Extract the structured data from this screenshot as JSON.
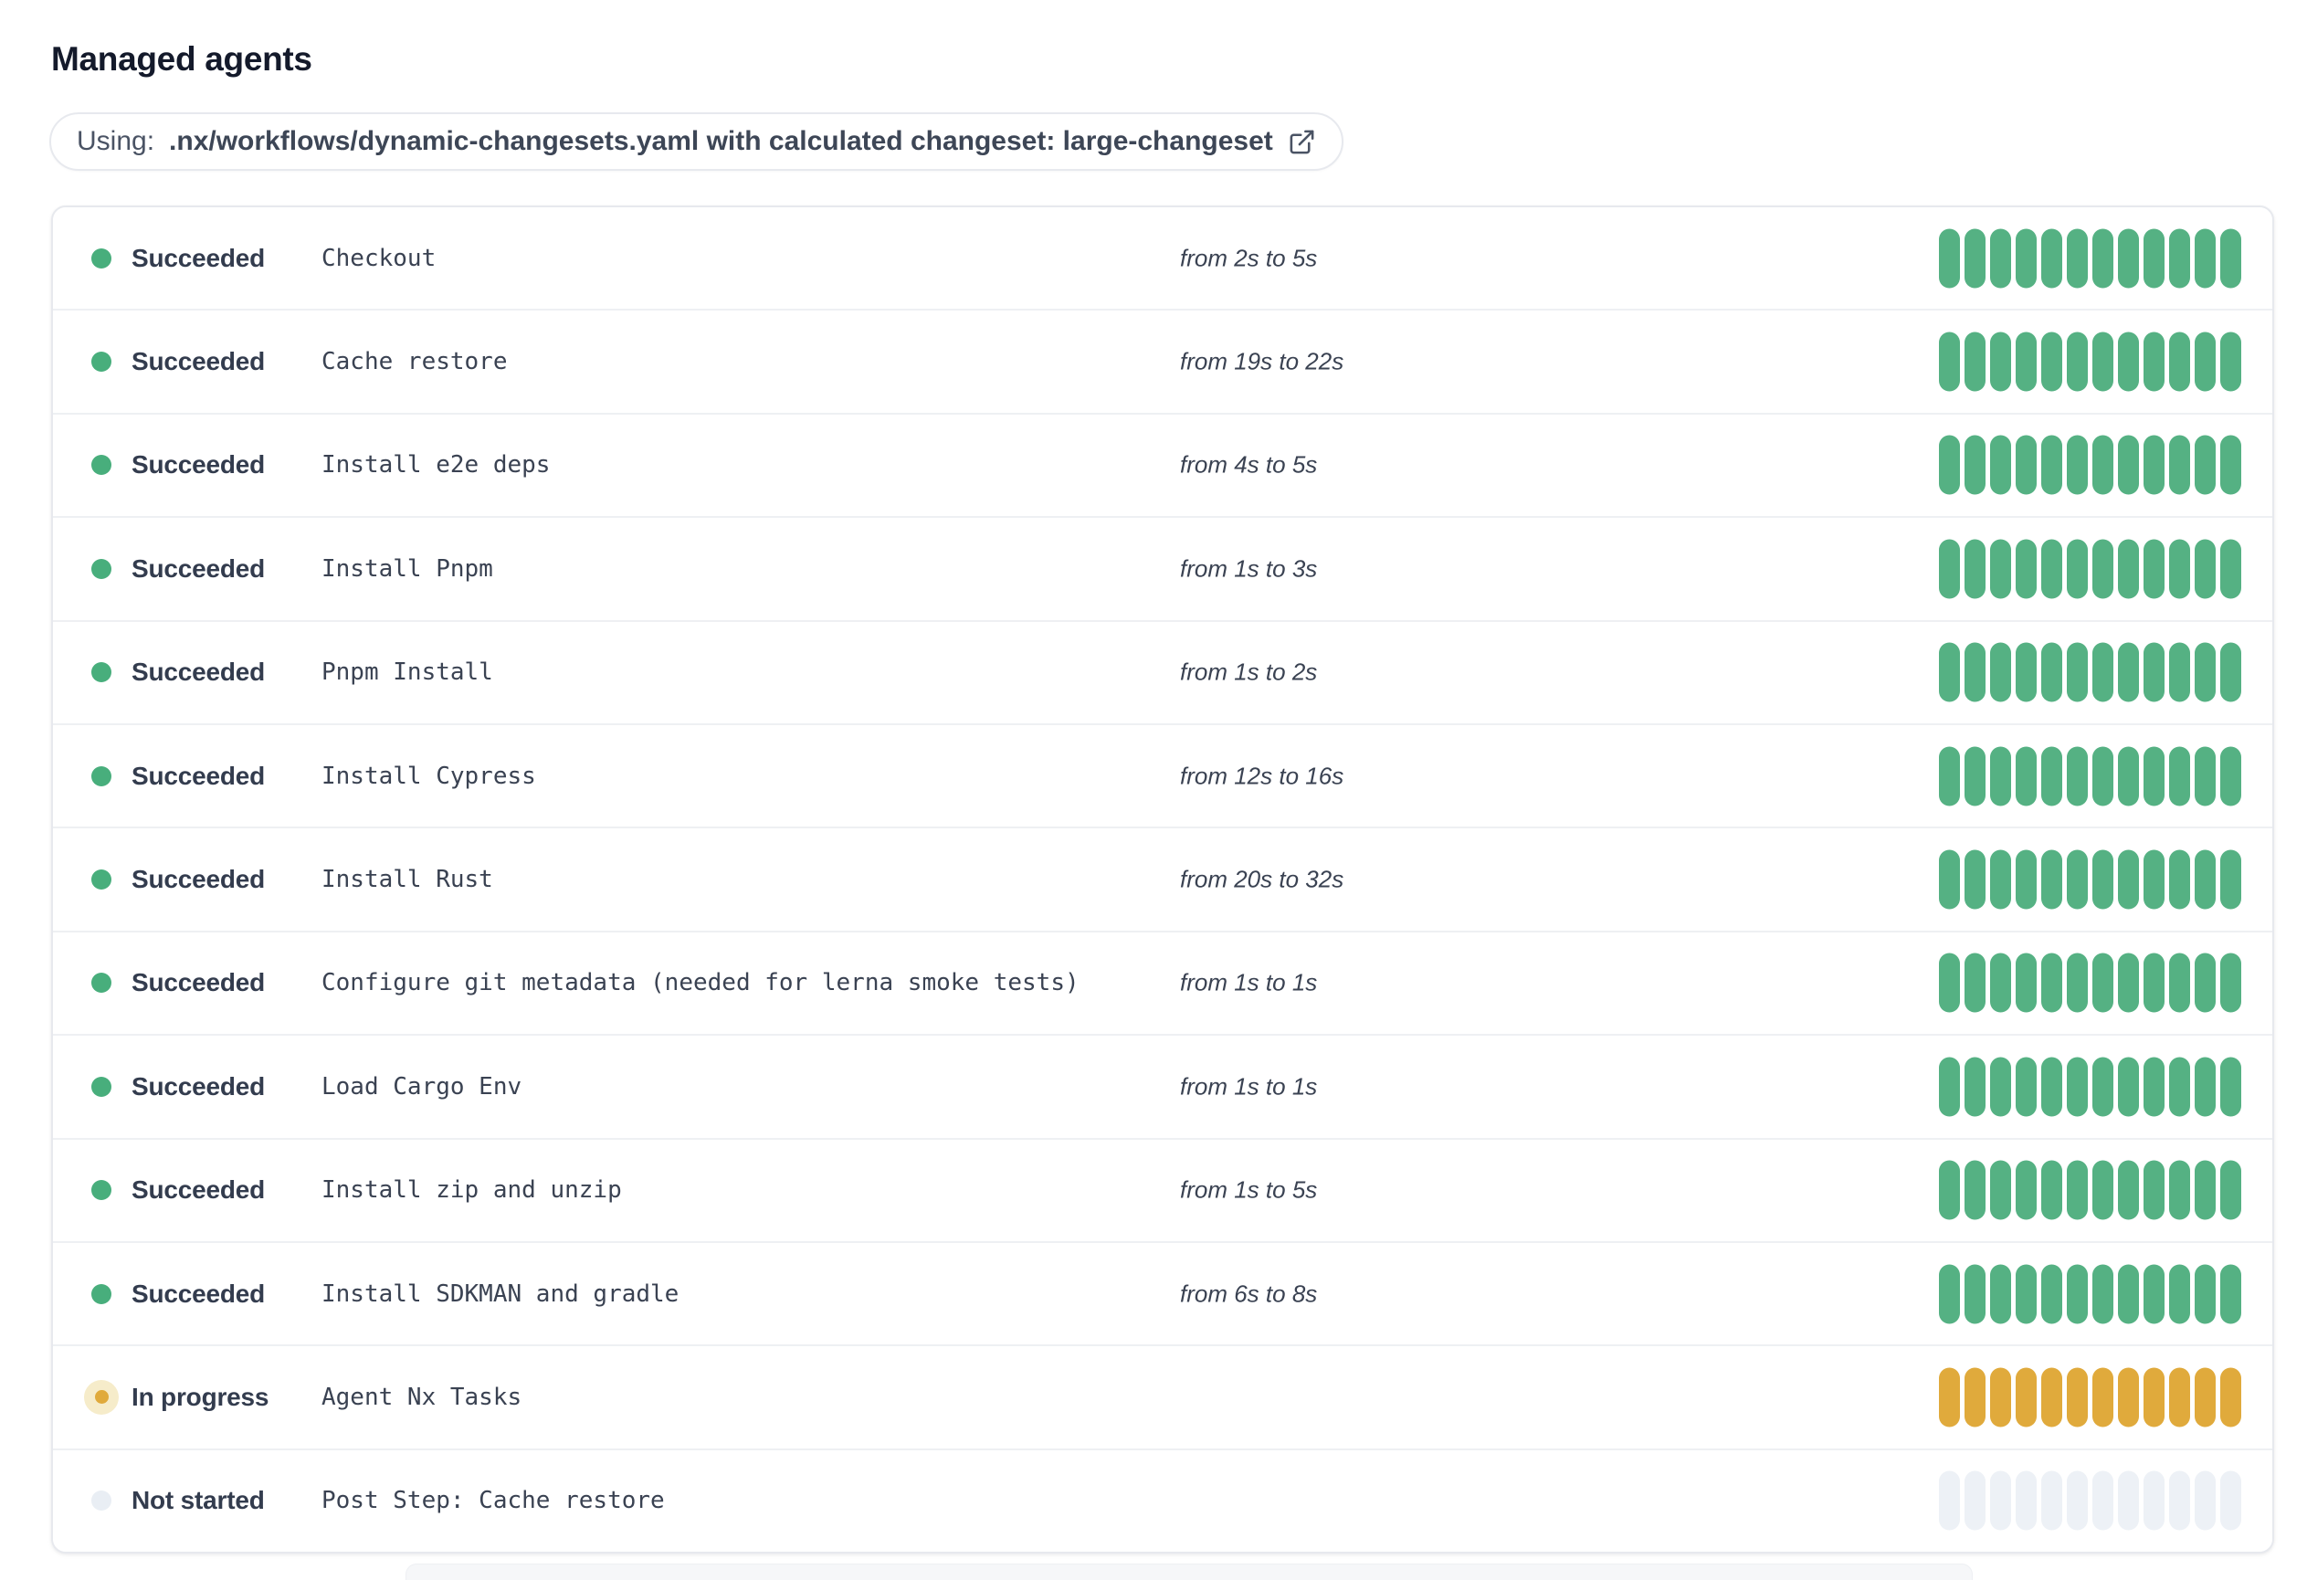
{
  "page": {
    "title": "Managed agents"
  },
  "workflow_banner": {
    "prefix_label": "Using:",
    "config_text": ".nx/workflows/dynamic-changesets.yaml with calculated changeset: large-changeset",
    "icon": "external-link-icon"
  },
  "agents_list": {
    "segments_per_row": 12,
    "rows": [
      {
        "state": "succeeded",
        "status_label": "Succeeded",
        "step": "Checkout",
        "duration": "from 2s to 5s"
      },
      {
        "state": "succeeded",
        "status_label": "Succeeded",
        "step": "Cache restore",
        "duration": "from 19s to 22s"
      },
      {
        "state": "succeeded",
        "status_label": "Succeeded",
        "step": "Install e2e deps",
        "duration": "from 4s to 5s"
      },
      {
        "state": "succeeded",
        "status_label": "Succeeded",
        "step": "Install Pnpm",
        "duration": "from 1s to 3s"
      },
      {
        "state": "succeeded",
        "status_label": "Succeeded",
        "step": "Pnpm Install",
        "duration": "from 1s to 2s"
      },
      {
        "state": "succeeded",
        "status_label": "Succeeded",
        "step": "Install Cypress",
        "duration": "from 12s to 16s"
      },
      {
        "state": "succeeded",
        "status_label": "Succeeded",
        "step": "Install Rust",
        "duration": "from 20s to 32s"
      },
      {
        "state": "succeeded",
        "status_label": "Succeeded",
        "step": "Configure git metadata (needed for lerna smoke tests)",
        "duration": "from 1s to 1s"
      },
      {
        "state": "succeeded",
        "status_label": "Succeeded",
        "step": "Load Cargo Env",
        "duration": "from 1s to 1s"
      },
      {
        "state": "succeeded",
        "status_label": "Succeeded",
        "step": "Install zip and unzip",
        "duration": "from 1s to 5s"
      },
      {
        "state": "succeeded",
        "status_label": "Succeeded",
        "step": "Install SDKMAN and gradle",
        "duration": "from 6s to 8s"
      },
      {
        "state": "in_progress",
        "status_label": "In progress",
        "step": "Agent Nx Tasks",
        "duration": ""
      },
      {
        "state": "not_started",
        "status_label": "Not started",
        "step": "Post Step: Cache restore",
        "duration": ""
      }
    ]
  },
  "colors": {
    "succeeded": "#55b183",
    "succeeded_dot": "#48ae7c",
    "in_progress": "#e0aa3c",
    "in_progress_halo": "#f6ecca",
    "not_started": "#edf1f6",
    "not_started_dot": "#e9eef4",
    "title_text": "#141a2b",
    "body_text": "#3a4252",
    "border": "#e7e9ee"
  }
}
